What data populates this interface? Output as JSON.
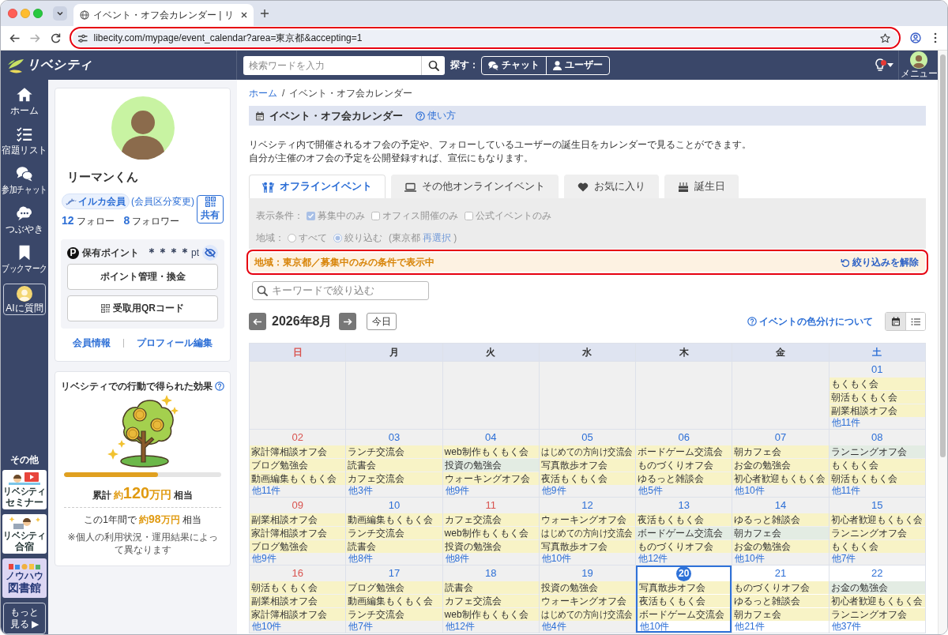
{
  "browser": {
    "tab_title": "イベント・オフ会カレンダー | リ",
    "url": "libecity.com/mypage/event_calendar?area=東京都&accepting=1",
    "url_highlighted": true
  },
  "header": {
    "logo": "リベシティ",
    "search_placeholder": "検索ワードを入力",
    "find_label": "探す：",
    "find_buttons": [
      {
        "kind": "chat",
        "label": "チャット"
      },
      {
        "kind": "user",
        "label": "ユーザー"
      }
    ],
    "notification_alert": true,
    "menu_label": "メニュー"
  },
  "nav": {
    "items": [
      {
        "kind": "home",
        "label": "ホーム"
      },
      {
        "kind": "tasks",
        "label": "宿題リスト"
      },
      {
        "kind": "chat",
        "label": "参加チャット"
      },
      {
        "kind": "murmur",
        "label": "つぶやき"
      },
      {
        "kind": "bookmark",
        "label": "ブックマーク"
      }
    ],
    "ai_button": "AIに質問",
    "other_label": "その他",
    "banners": [
      {
        "kind": "seminar",
        "lines": [
          "リベシティ",
          "セミナー"
        ]
      },
      {
        "kind": "camp",
        "lines": [
          "リベシティ",
          "合宿"
        ]
      },
      {
        "kind": "library",
        "lines": [
          "ノウハウ",
          "図書館"
        ]
      }
    ],
    "more": "もっと見る ▶"
  },
  "profile": {
    "name": "リーマンくん",
    "badge": "イルカ会員",
    "change_link": "(会員区分変更)",
    "share": "共有",
    "follow_count": "12",
    "follow_label": "フォロー",
    "follower_count": "8",
    "follower_label": "フォロワー",
    "points": {
      "icon_letter": "P",
      "label": "保有ポイント",
      "value": "＊＊＊＊",
      "unit": "pt",
      "hidden": true,
      "buttons": [
        {
          "kind": "plain",
          "label": "ポイント管理・換金"
        },
        {
          "kind": "qr",
          "label": "受取用QRコード"
        }
      ]
    },
    "links": [
      "会員情報",
      "プロフィール編集"
    ]
  },
  "effect": {
    "title": "リベシティでの行動で得られた効果",
    "level": 0.6,
    "total": {
      "prefix": "累計",
      "approx": "約",
      "amount": "120",
      "unit": "万円",
      "suffix": "相当"
    },
    "year": {
      "prefix": "この1年間で",
      "approx": "約",
      "amount": "98",
      "unit": "万円",
      "suffix": "相当"
    },
    "note": "※個人の利用状況・運用結果によって異なります"
  },
  "breadcrumb": {
    "items": [
      "ホーム",
      "イベント・オフ会カレンダー"
    ],
    "separator": "/"
  },
  "page_title": {
    "title": "イベント・オフ会カレンダー",
    "help": "使い方"
  },
  "description": [
    "リベシティ内で開催されるオフ会の予定や、フォローしているユーザーの誕生日をカレンダーで見ることができます。",
    "自分が主催のオフ会の予定を公開登録すれば、宣伝にもなります。"
  ],
  "tabs": [
    {
      "kind": "offline",
      "label": "オフラインイベント",
      "selected": true
    },
    {
      "kind": "online",
      "label": "その他オンラインイベント",
      "selected": false
    },
    {
      "kind": "favorite",
      "label": "お気に入り",
      "selected": false
    },
    {
      "kind": "birthday",
      "label": "誕生日",
      "selected": false
    }
  ],
  "filters": {
    "disabled": true,
    "condition_label": "表示条件：",
    "conditions": [
      {
        "label": "募集中のみ",
        "checked": true
      },
      {
        "label": "オフィス開催のみ",
        "checked": false
      },
      {
        "label": "公式イベントのみ",
        "checked": false
      }
    ],
    "area_label": "地域：",
    "areas": [
      {
        "label": "すべて",
        "selected": false
      },
      {
        "label": "絞り込む",
        "selected": true
      }
    ],
    "area_value": "(東京都",
    "reselect": "再選択",
    "area_close": ")"
  },
  "notice": {
    "text": "地域：東京都／募集中のみの条件で表示中",
    "clear": "絞り込みを解除",
    "highlighted": true
  },
  "keyword_filter": {
    "placeholder": "キーワードで絞り込む"
  },
  "calendar": {
    "month": "2026年8月",
    "today": "今日",
    "color_help": "イベントの色分けについて",
    "views": [
      {
        "kind": "month",
        "selected": true
      },
      {
        "kind": "list",
        "selected": false
      }
    ],
    "weekdays": [
      {
        "label": "日",
        "kind": "sunday"
      },
      {
        "label": "月",
        "kind": "weekday"
      },
      {
        "label": "火",
        "kind": "weekday"
      },
      {
        "label": "水",
        "kind": "weekday"
      },
      {
        "label": "木",
        "kind": "weekday"
      },
      {
        "label": "金",
        "kind": "weekday"
      },
      {
        "label": "土",
        "kind": "saturday"
      }
    ],
    "weeks": [
      [
        {
          "kind": "blank"
        },
        {
          "kind": "blank"
        },
        {
          "kind": "blank"
        },
        {
          "kind": "blank"
        },
        {
          "kind": "blank"
        },
        {
          "kind": "blank"
        },
        {
          "kind": "day",
          "date": "01",
          "holiday": false,
          "past": true,
          "today": false,
          "events": [
            {
              "title": "もくもく会",
              "color": "#f8f3c6"
            },
            {
              "title": "朝活もくもく会",
              "color": "#f8f3c6"
            },
            {
              "title": "副業相談オフ会",
              "color": "#f8f3c6"
            }
          ],
          "more": "他11件"
        }
      ],
      [
        {
          "kind": "day",
          "date": "02",
          "holiday": true,
          "past": true,
          "today": false,
          "events": [
            {
              "title": "家計簿相談オフ会",
              "color": "#f8f3c6"
            },
            {
              "title": "ブログ勉強会",
              "color": "#f8f3c6"
            },
            {
              "title": "動画編集もくもく会",
              "color": "#f8f3c6"
            }
          ],
          "more": "他11件"
        },
        {
          "kind": "day",
          "date": "03",
          "holiday": false,
          "past": true,
          "today": false,
          "events": [
            {
              "title": "ランチ交流会",
              "color": "#f8f3c6"
            },
            {
              "title": "読書会",
              "color": "#f8f3c6"
            },
            {
              "title": "カフェ交流会",
              "color": "#f8f3c6"
            }
          ],
          "more": "他3件"
        },
        {
          "kind": "day",
          "date": "04",
          "holiday": false,
          "past": true,
          "today": false,
          "events": [
            {
              "title": "web制作もくもく会",
              "color": "#f8f3c6"
            },
            {
              "title": "投資の勉強会",
              "color": "#e3ece3"
            },
            {
              "title": "ウォーキングオフ会",
              "color": "#f8f3c6"
            }
          ],
          "more": "他9件"
        },
        {
          "kind": "day",
          "date": "05",
          "holiday": false,
          "past": true,
          "today": false,
          "events": [
            {
              "title": "はじめての方向け交流会",
              "color": "#f8f3c6"
            },
            {
              "title": "写真散歩オフ会",
              "color": "#f8f3c6"
            },
            {
              "title": "夜活もくもく会",
              "color": "#f8f3c6"
            }
          ],
          "more": "他9件"
        },
        {
          "kind": "day",
          "date": "06",
          "holiday": false,
          "past": true,
          "today": false,
          "events": [
            {
              "title": "ボードゲーム交流会",
              "color": "#f8f3c6"
            },
            {
              "title": "ものづくりオフ会",
              "color": "#f8f3c6"
            },
            {
              "title": "ゆるっと雑談会",
              "color": "#f8f3c6"
            }
          ],
          "more": "他5件"
        },
        {
          "kind": "day",
          "date": "07",
          "holiday": false,
          "past": true,
          "today": false,
          "events": [
            {
              "title": "朝カフェ会",
              "color": "#f8f3c6"
            },
            {
              "title": "お金の勉強会",
              "color": "#f8f3c6"
            },
            {
              "title": "初心者歓迎もくもく会",
              "color": "#f8f3c6"
            }
          ],
          "more": "他10件"
        },
        {
          "kind": "day",
          "date": "08",
          "holiday": false,
          "past": true,
          "today": false,
          "events": [
            {
              "title": "ランニングオフ会",
              "color": "#e3ece3"
            },
            {
              "title": "もくもく会",
              "color": "#f8f3c6"
            },
            {
              "title": "朝活もくもく会",
              "color": "#f8f3c6"
            }
          ],
          "more": "他11件"
        }
      ],
      [
        {
          "kind": "day",
          "date": "09",
          "holiday": true,
          "past": true,
          "today": false,
          "events": [
            {
              "title": "副業相談オフ会",
              "color": "#f8f3c6"
            },
            {
              "title": "家計簿相談オフ会",
              "color": "#f8f3c6"
            },
            {
              "title": "ブログ勉強会",
              "color": "#f8f3c6"
            }
          ],
          "more": "他9件"
        },
        {
          "kind": "day",
          "date": "10",
          "holiday": false,
          "past": true,
          "today": false,
          "events": [
            {
              "title": "動画編集もくもく会",
              "color": "#f8f3c6"
            },
            {
              "title": "ランチ交流会",
              "color": "#f8f3c6"
            },
            {
              "title": "読書会",
              "color": "#f8f3c6"
            }
          ],
          "more": "他8件"
        },
        {
          "kind": "day",
          "date": "11",
          "holiday": true,
          "past": true,
          "today": false,
          "events": [
            {
              "title": "カフェ交流会",
              "color": "#f8f3c6"
            },
            {
              "title": "web制作もくもく会",
              "color": "#f8f3c6"
            },
            {
              "title": "投資の勉強会",
              "color": "#f8f3c6"
            }
          ],
          "more": "他8件"
        },
        {
          "kind": "day",
          "date": "12",
          "holiday": false,
          "past": true,
          "today": false,
          "events": [
            {
              "title": "ウォーキングオフ会",
              "color": "#f8f3c6"
            },
            {
              "title": "はじめての方向け交流会",
              "color": "#f8f3c6"
            },
            {
              "title": "写真散歩オフ会",
              "color": "#f8f3c6"
            }
          ],
          "more": "他10件"
        },
        {
          "kind": "day",
          "date": "13",
          "holiday": false,
          "past": true,
          "today": false,
          "events": [
            {
              "title": "夜活もくもく会",
              "color": "#f8f3c6"
            },
            {
              "title": "ボードゲーム交流会",
              "color": "#e3ece3"
            },
            {
              "title": "ものづくりオフ会",
              "color": "#f8f3c6"
            }
          ],
          "more": "他12件"
        },
        {
          "kind": "day",
          "date": "14",
          "holiday": false,
          "past": true,
          "today": false,
          "events": [
            {
              "title": "ゆるっと雑談会",
              "color": "#f8f3c6"
            },
            {
              "title": "朝カフェ会",
              "color": "#e3ece3"
            },
            {
              "title": "お金の勉強会",
              "color": "#f8f3c6"
            }
          ],
          "more": "他10件"
        },
        {
          "kind": "day",
          "date": "15",
          "holiday": false,
          "past": true,
          "today": false,
          "events": [
            {
              "title": "初心者歓迎もくもく会",
              "color": "#f8f3c6"
            },
            {
              "title": "ランニングオフ会",
              "color": "#f8f3c6"
            },
            {
              "title": "もくもく会",
              "color": "#f8f3c6"
            }
          ],
          "more": "他7件"
        }
      ],
      [
        {
          "kind": "day",
          "date": "16",
          "holiday": true,
          "past": true,
          "today": false,
          "events": [
            {
              "title": "朝活もくもく会",
              "color": "#f8f3c6"
            },
            {
              "title": "副業相談オフ会",
              "color": "#f8f3c6"
            },
            {
              "title": "家計簿相談オフ会",
              "color": "#f8f3c6"
            }
          ],
          "more": "他10件"
        },
        {
          "kind": "day",
          "date": "17",
          "holiday": false,
          "past": true,
          "today": false,
          "events": [
            {
              "title": "ブログ勉強会",
              "color": "#f8f3c6"
            },
            {
              "title": "動画編集もくもく会",
              "color": "#f8f3c6"
            },
            {
              "title": "ランチ交流会",
              "color": "#f8f3c6"
            }
          ],
          "more": "他7件"
        },
        {
          "kind": "day",
          "date": "18",
          "holiday": false,
          "past": true,
          "today": false,
          "events": [
            {
              "title": "読書会",
              "color": "#f8f3c6"
            },
            {
              "title": "カフェ交流会",
              "color": "#f8f3c6"
            },
            {
              "title": "web制作もくもく会",
              "color": "#f8f3c6"
            }
          ],
          "more": "他12件"
        },
        {
          "kind": "day",
          "date": "19",
          "holiday": false,
          "past": true,
          "today": false,
          "events": [
            {
              "title": "投資の勉強会",
              "color": "#f8f3c6"
            },
            {
              "title": "ウォーキングオフ会",
              "color": "#f8f3c6"
            },
            {
              "title": "はじめての方向け交流会",
              "color": "#f8f3c6"
            }
          ],
          "more": "他4件"
        },
        {
          "kind": "day",
          "date": "20",
          "holiday": false,
          "past": false,
          "today": true,
          "events": [
            {
              "title": "写真散歩オフ会",
              "color": "#f8f3c6"
            },
            {
              "title": "夜活もくもく会",
              "color": "#f8f3c6"
            },
            {
              "title": "ボードゲーム交流会",
              "color": "#f8f3c6"
            }
          ],
          "more": "他10件"
        },
        {
          "kind": "day",
          "date": "21",
          "holiday": false,
          "past": false,
          "today": false,
          "events": [
            {
              "title": "ものづくりオフ会",
              "color": "#f8f3c6"
            },
            {
              "title": "ゆるっと雑談会",
              "color": "#f8f3c6"
            },
            {
              "title": "朝カフェ会",
              "color": "#f8f3c6"
            }
          ],
          "more": "他21件"
        },
        {
          "kind": "day",
          "date": "22",
          "holiday": false,
          "past": false,
          "today": false,
          "events": [
            {
              "title": "お金の勉強会",
              "color": "#e3ece3"
            },
            {
              "title": "初心者歓迎もくもく会",
              "color": "#f8f3c6"
            },
            {
              "title": "ランニングオフ会",
              "color": "#f8f3c6"
            }
          ],
          "more": "他37件"
        }
      ]
    ]
  }
}
